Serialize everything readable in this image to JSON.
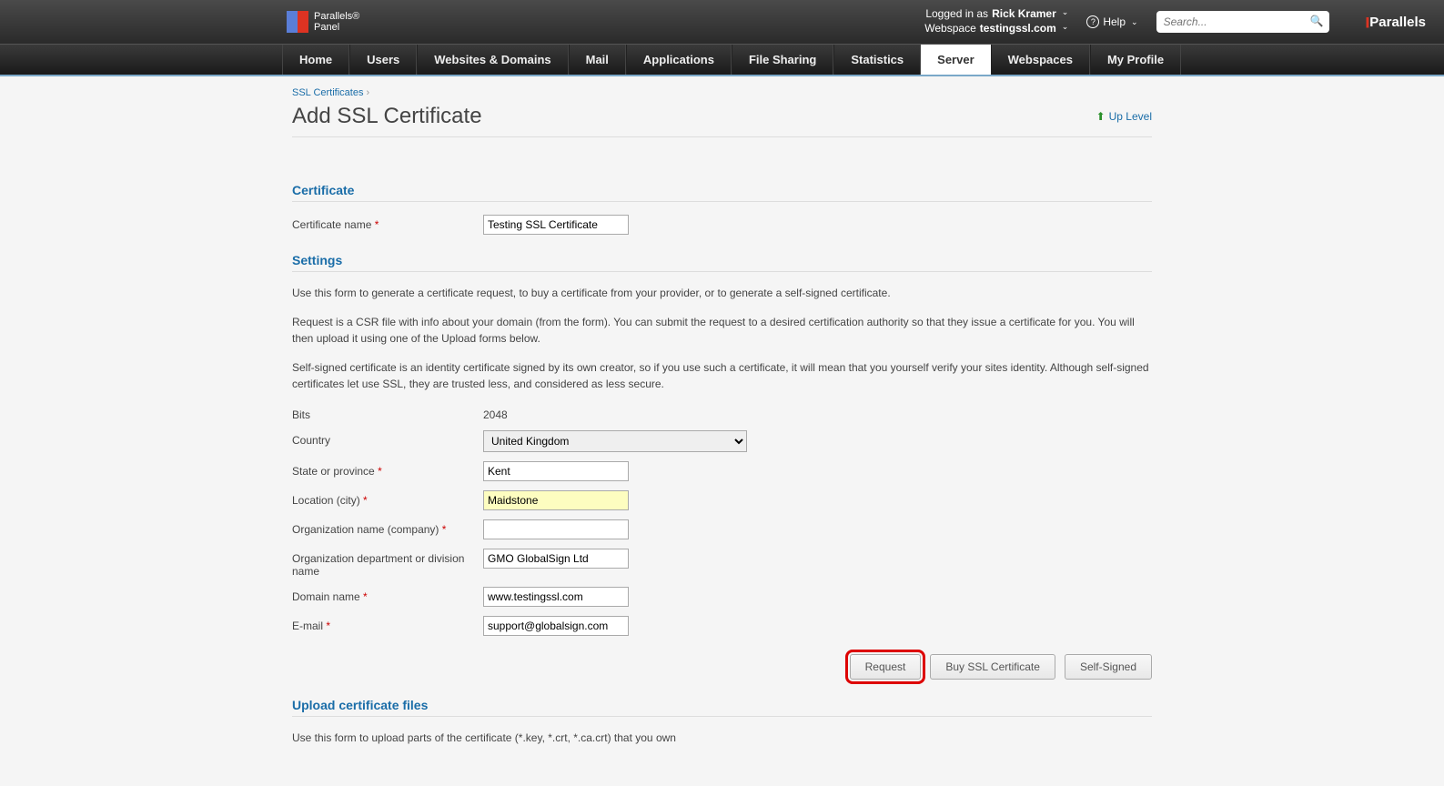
{
  "header": {
    "logo1": "Parallels®",
    "logo2": "Panel",
    "logged_in_label": "Logged in as",
    "user_name": "Rick Kramer",
    "webspace_label": "Webspace",
    "webspace_value": "testingssl.com",
    "help_label": "Help",
    "search_placeholder": "Search...",
    "brand": "Parallels"
  },
  "nav": {
    "items": [
      "Home",
      "Users",
      "Websites & Domains",
      "Mail",
      "Applications",
      "File Sharing",
      "Statistics",
      "Server",
      "Webspaces",
      "My Profile"
    ],
    "active": "Server"
  },
  "breadcrumb": {
    "link": "SSL Certificates",
    "sep": "›"
  },
  "title": "Add SSL Certificate",
  "up_level": "Up Level",
  "sections": {
    "certificate": "Certificate",
    "settings": "Settings",
    "upload": "Upload certificate files"
  },
  "fields": {
    "cert_name_label": "Certificate name",
    "cert_name_value": "Testing SSL Certificate",
    "desc1": "Use this form to generate a certificate request, to buy a certificate from your provider, or to generate a self-signed certificate.",
    "desc2": "Request is a CSR file with info about your domain (from the form). You can submit the request to a desired certification authority so that they issue a certificate for you. You will then upload it using one of the Upload forms below.",
    "desc3": "Self-signed certificate is an identity certificate signed by its own creator, so if you use such a certificate, it will mean that you yourself verify your sites identity. Although self-signed certificates let use SSL, they are trusted less, and considered as less secure.",
    "bits_label": "Bits",
    "bits_value": "2048",
    "country_label": "Country",
    "country_value": "United Kingdom",
    "state_label": "State or province",
    "state_value": "Kent",
    "city_label": "Location (city)",
    "city_value": "Maidstone",
    "org_label": "Organization name (company)",
    "org_value": "",
    "dept_label": "Organization department or division name",
    "dept_value": "GMO GlobalSign Ltd",
    "domain_label": "Domain name",
    "domain_value": "www.testingssl.com",
    "email_label": "E-mail",
    "email_value": "support@globalsign.com",
    "upload_desc": "Use this form to upload parts of the certificate (*.key, *.crt, *.ca.crt) that you own"
  },
  "buttons": {
    "request": "Request",
    "buy": "Buy SSL Certificate",
    "self_signed": "Self-Signed"
  }
}
